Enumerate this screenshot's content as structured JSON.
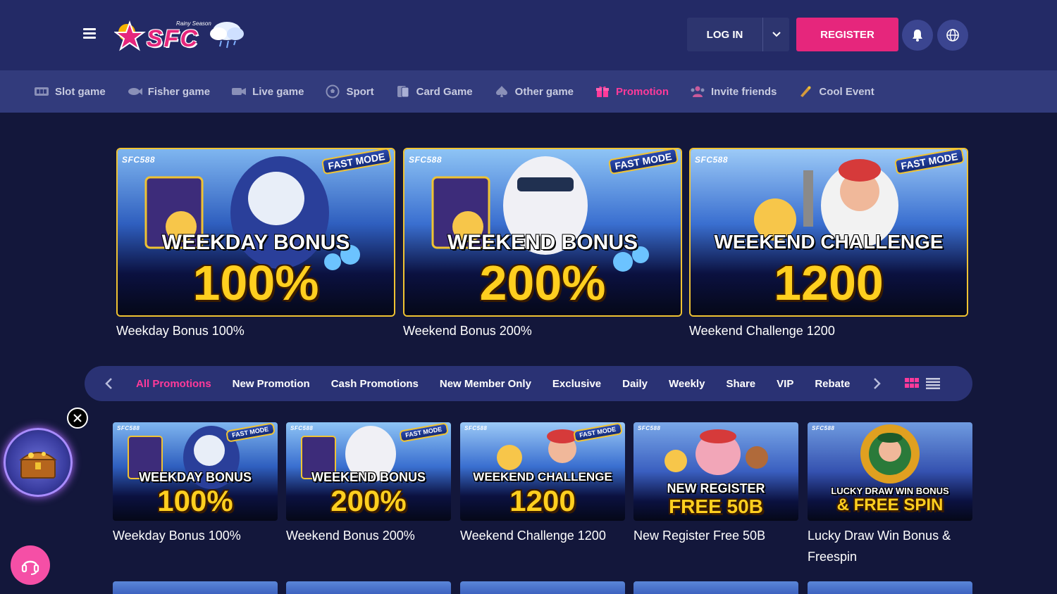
{
  "header": {
    "logo_text": "SFC",
    "logo_subtext": "Rainy Season",
    "login_label": "LOG IN",
    "register_label": "REGISTER",
    "accent_color": "#e6267c"
  },
  "nav": {
    "items": [
      {
        "label": "Slot game",
        "icon": "slot-machine-icon"
      },
      {
        "label": "Fisher game",
        "icon": "fish-icon"
      },
      {
        "label": "Live game",
        "icon": "live-camera-icon"
      },
      {
        "label": "Sport",
        "icon": "soccer-ball-icon"
      },
      {
        "label": "Card Game",
        "icon": "playing-cards-icon"
      },
      {
        "label": "Other game",
        "icon": "spade-icon"
      },
      {
        "label": "Promotion",
        "icon": "gift-icon",
        "active": true
      },
      {
        "label": "Invite friends",
        "icon": "people-icon"
      },
      {
        "label": "Cool Event",
        "icon": "megaphone-icon"
      }
    ]
  },
  "featured": [
    {
      "caption": "Weekday Bonus 100%",
      "title": "WEEKDAY BONUS",
      "amount": "100%",
      "brand": "SFC588",
      "badge": "FAST MODE"
    },
    {
      "caption": "Weekend Bonus 200%",
      "title": "WEEKEND BONUS",
      "amount": "200%",
      "brand": "SFC588",
      "badge": "FAST MODE"
    },
    {
      "caption": "Weekend Challenge 1200",
      "title": "WEEKEND CHALLENGE",
      "amount": "1200",
      "brand": "SFC588",
      "badge": "FAST MODE"
    }
  ],
  "filter": {
    "tabs": [
      "All Promotions",
      "New Promotion",
      "Cash Promotions",
      "New Member Only",
      "Exclusive",
      "Daily",
      "Weekly",
      "Share",
      "VIP",
      "Rebate"
    ],
    "active_index": 0
  },
  "promos": [
    {
      "caption": "Weekday Bonus 100%",
      "title": "WEEKDAY BONUS",
      "amount": "100%",
      "brand": "SFC588",
      "badge": "FAST MODE"
    },
    {
      "caption": "Weekend Bonus 200%",
      "title": "WEEKEND BONUS",
      "amount": "200%",
      "brand": "SFC588",
      "badge": "FAST MODE"
    },
    {
      "caption": "Weekend Challenge 1200",
      "title": "WEEKEND CHALLENGE",
      "amount": "1200",
      "brand": "SFC588",
      "badge": "FAST MODE"
    },
    {
      "caption": "New Register Free 50B",
      "title": "NEW REGISTER",
      "amount": "FREE 50B",
      "brand": "SFC588",
      "badge": ""
    },
    {
      "caption": "Lucky Draw Win Bonus & Freespin",
      "title": "LUCKY DRAW WIN BONUS",
      "amount": "& FREE SPIN",
      "brand": "SFC588",
      "badge": ""
    }
  ]
}
